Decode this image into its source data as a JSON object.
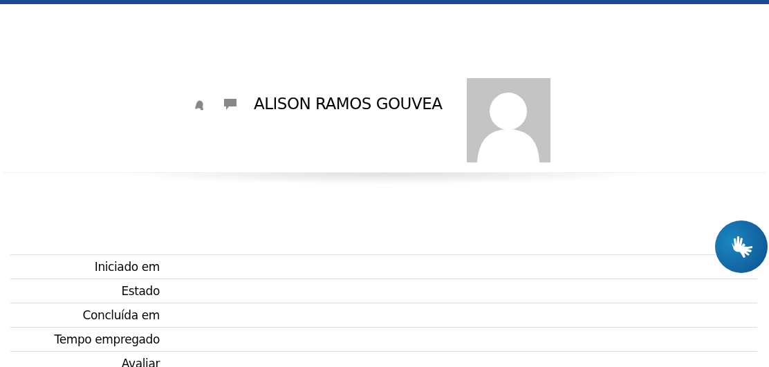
{
  "user": {
    "name": "ALISON RAMOS GOUVEA"
  },
  "summary": {
    "rows": [
      {
        "label": "Iniciado em"
      },
      {
        "label": "Estado"
      },
      {
        "label": "Concluída em"
      },
      {
        "label": "Tempo empregado"
      },
      {
        "label": "Avaliar"
      }
    ]
  }
}
